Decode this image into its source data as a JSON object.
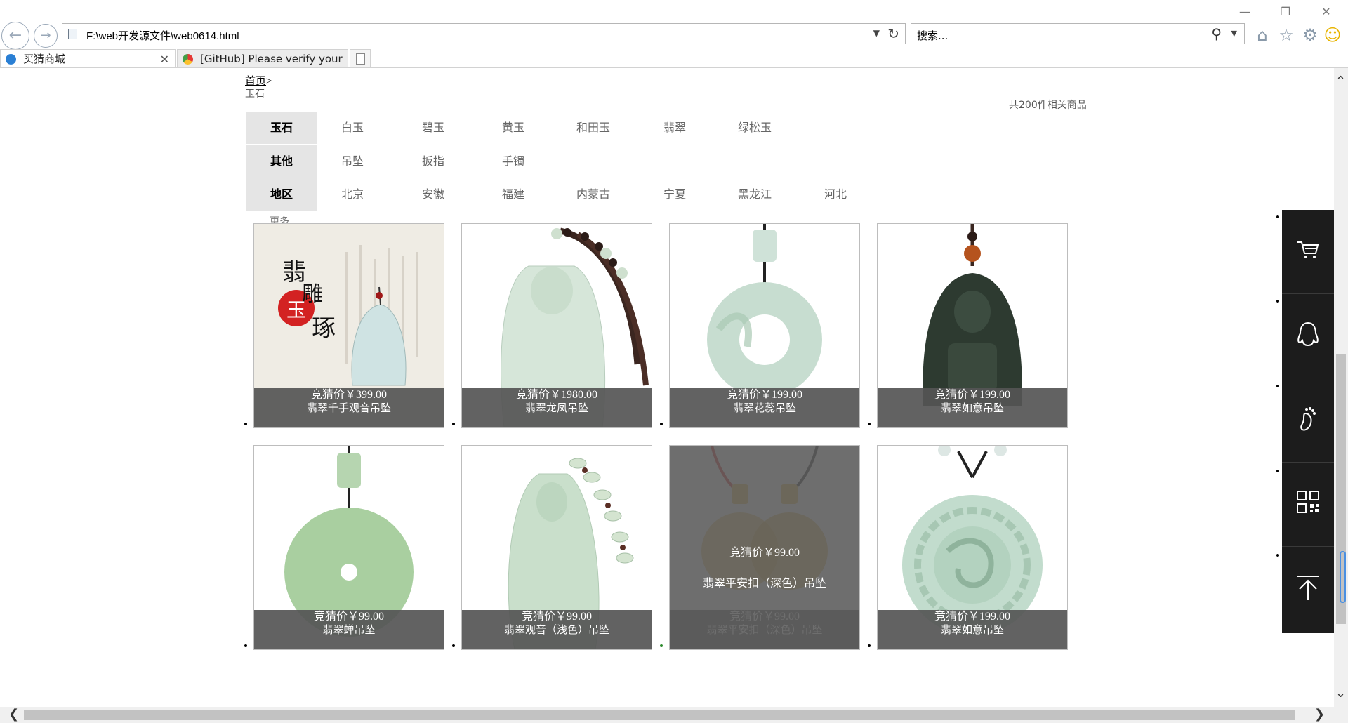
{
  "browser": {
    "address_url": "F:\\web开发源文件\\web0614.html",
    "search_placeholder": "搜索...",
    "tabs": [
      {
        "label": "买猜商城",
        "active": true
      },
      {
        "label": "[GitHub] Please verify your ...",
        "active": false
      }
    ],
    "toolbar_icons": [
      "home-icon",
      "favorites-star-icon",
      "settings-gear-icon",
      "smiley-feedback-icon"
    ]
  },
  "page": {
    "breadcrumb": {
      "home": "首页",
      "separator": ">",
      "current": "玉石"
    },
    "result_count": "共200件相关商品",
    "filters": [
      {
        "head": "玉石",
        "options": [
          "白玉",
          "碧玉",
          "黄玉",
          "和田玉",
          "翡翠",
          "绿松玉"
        ]
      },
      {
        "head": "其他",
        "options": [
          "吊坠",
          "扳指",
          "手镯"
        ]
      },
      {
        "head": "地区",
        "options": [
          "北京",
          "安徽",
          "福建",
          "内蒙古",
          "宁夏",
          "黑龙江",
          "河北"
        ]
      }
    ],
    "more_label": "更多",
    "products": [
      {
        "price": "竞猜价￥399.00",
        "name": "翡翠千手观音吊坠",
        "image": "pendant-guanyin-with-calligraphy",
        "hovered": false
      },
      {
        "price": "竞猜价￥1980.00",
        "name": "翡翠龙凤吊坠",
        "image": "pendant-carved-buddha-light",
        "hovered": false
      },
      {
        "price": "竞猜价￥199.00",
        "name": "翡翠花蕊吊坠",
        "image": "pendant-donut-ring",
        "hovered": false
      },
      {
        "price": "竞猜价￥199.00",
        "name": "翡翠如意吊坠",
        "image": "pendant-dark-buddha",
        "hovered": false
      },
      {
        "price": "竞猜价￥99.00",
        "name": "翡翠蝉吊坠",
        "image": "pendant-disc",
        "hovered": false
      },
      {
        "price": "竞猜价￥99.00",
        "name": "翡翠观音（浅色）吊坠",
        "image": "pendant-guanyin-light",
        "hovered": false
      },
      {
        "price": "竞猜价￥99.00",
        "name": "翡翠平安扣（深色）吊坠",
        "image": "pendant-pingan-dark",
        "hovered": true
      },
      {
        "price": "竞猜价￥199.00",
        "name": "翡翠如意吊坠",
        "image": "pendant-dragon-round",
        "hovered": false
      }
    ],
    "logo_text": "翡雕玉琢"
  },
  "sidebar": {
    "items": [
      "cart-icon",
      "qq-penguin-icon",
      "footprint-icon",
      "qr-code-icon",
      "back-to-top-icon"
    ]
  },
  "colors": {
    "caption_bg": "#555555",
    "filter_head_bg": "#e5e5e5",
    "sidebar_bg": "#1c1c1c",
    "jade_light": "#cfe3cf",
    "jade_dark": "#2f3a30"
  }
}
